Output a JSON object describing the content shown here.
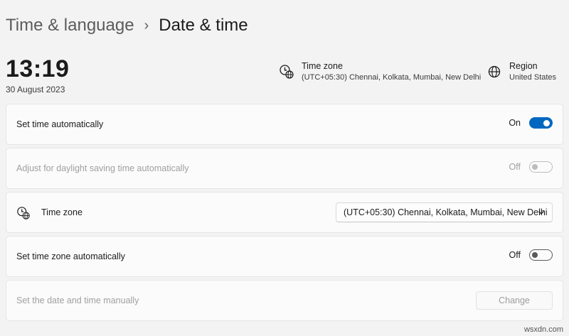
{
  "breadcrumb": {
    "parent": "Time & language",
    "separator": "›",
    "current": "Date & time"
  },
  "clock": {
    "time": "13:19",
    "date": "30 August 2023"
  },
  "summary": {
    "timezone": {
      "title": "Time zone",
      "value": "(UTC+05:30) Chennai, Kolkata, Mumbai, New Delhi",
      "icon": "clock-globe-icon"
    },
    "region": {
      "title": "Region",
      "value": "United States",
      "icon": "globe-icon"
    }
  },
  "settings": {
    "set_time_auto": {
      "label": "Set time automatically",
      "state": "On",
      "enabled": true
    },
    "daylight_saving": {
      "label": "Adjust for daylight saving time automatically",
      "state": "Off",
      "enabled": false
    },
    "time_zone": {
      "label": "Time zone",
      "selected": "(UTC+05:30) Chennai, Kolkata, Mumbai, New Delhi"
    },
    "set_tz_auto": {
      "label": "Set time zone automatically",
      "state": "Off",
      "enabled": true
    },
    "manual": {
      "label": "Set the date and time manually",
      "button": "Change",
      "enabled": false
    }
  },
  "watermark": "wsxdn.com",
  "colors": {
    "accent": "#0067c0",
    "background": "#f3f3f3",
    "card": "#fbfbfb"
  }
}
